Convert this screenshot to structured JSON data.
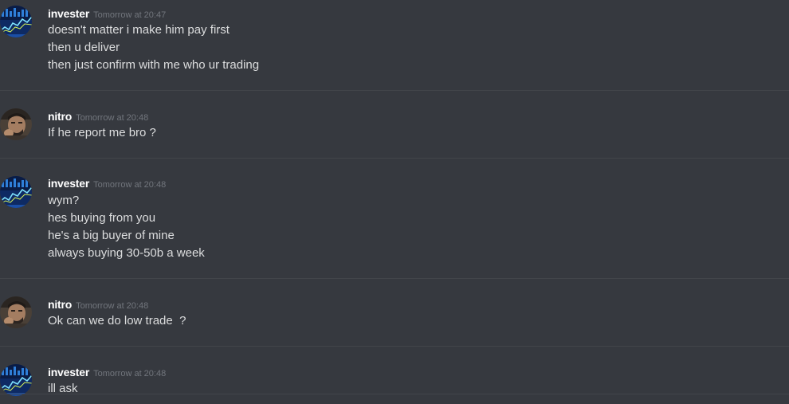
{
  "colors": {
    "background": "#36393f",
    "divider": "#42454a",
    "username": "#ffffff",
    "timestamp": "#72767d",
    "message_text": "#dcddde"
  },
  "messages": [
    {
      "author": "invester",
      "avatar_icon": "stock-chart-avatar",
      "timestamp": "Tomorrow at 20:47",
      "lines": [
        "doesn't matter i make him pay first",
        "then u deliver",
        "then just confirm with me who ur trading"
      ]
    },
    {
      "author": "nitro",
      "avatar_icon": "person-photo-avatar",
      "timestamp": "Tomorrow at 20:48",
      "lines": [
        "If he report me bro ?"
      ]
    },
    {
      "author": "invester",
      "avatar_icon": "stock-chart-avatar",
      "timestamp": "Tomorrow at 20:48",
      "lines": [
        "wym?",
        "hes buying from you",
        "he's a big buyer of mine",
        "always buying 30-50b a week"
      ]
    },
    {
      "author": "nitro",
      "avatar_icon": "person-photo-avatar",
      "timestamp": "Tomorrow at 20:48",
      "lines": [
        "Ok can we do low trade  ?"
      ]
    },
    {
      "author": "invester",
      "avatar_icon": "stock-chart-avatar",
      "timestamp": "Tomorrow at 20:48",
      "lines": [
        "ill ask"
      ]
    }
  ]
}
